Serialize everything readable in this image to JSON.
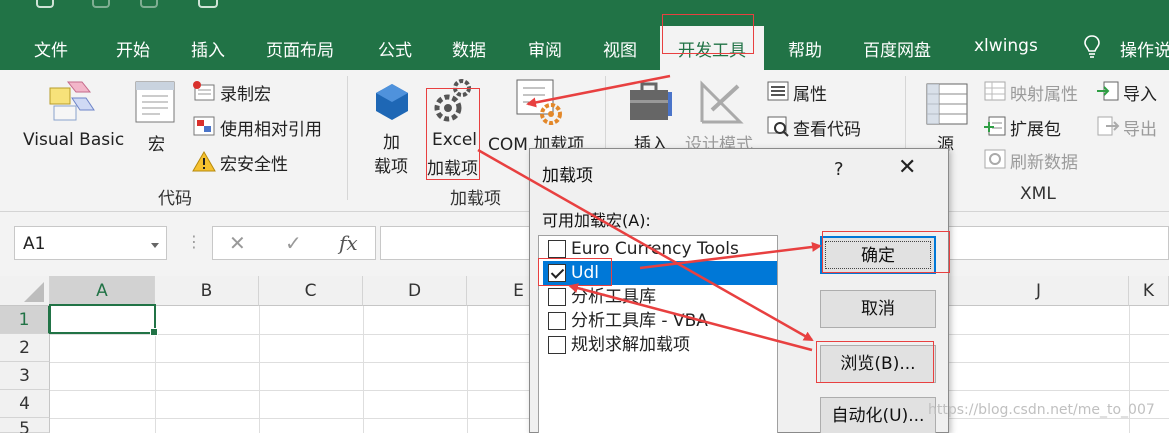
{
  "ribbon_tabs": [
    "文件",
    "开始",
    "插入",
    "页面布局",
    "公式",
    "数据",
    "审阅",
    "视图",
    "开发工具",
    "帮助",
    "百度网盘",
    "xlwings",
    "操作说"
  ],
  "active_tab": "开发工具",
  "code_group": {
    "visual_basic": "Visual Basic",
    "macros": "宏",
    "record_macro": "录制宏",
    "use_relative_refs": "使用相对引用",
    "macro_security": "宏安全性",
    "label": "代码"
  },
  "addins_group": {
    "addins_line1": "加",
    "addins_line2": "载项",
    "excel_addins_line1": "Excel",
    "excel_addins_line2": "加载项",
    "com_addins": "COM 加载项",
    "label": "加载项"
  },
  "controls_group": {
    "insert": "插入",
    "design_mode": "设计模式",
    "properties": "属性",
    "view_code": "查看代码"
  },
  "xml_group": {
    "source": "源",
    "map_properties": "映射属性",
    "expansion_packs": "扩展包",
    "refresh_data": "刷新数据",
    "import": "导入",
    "export": "导出",
    "label": "XML"
  },
  "formula_bar": {
    "name_box": "A1",
    "cancel": "✕",
    "enter": "✓",
    "fx": "fx"
  },
  "grid": {
    "columns": [
      "A",
      "B",
      "C",
      "D",
      "E",
      "J",
      "K"
    ],
    "rows": [
      "1",
      "2",
      "3",
      "4",
      "5"
    ]
  },
  "dialog": {
    "title": "加载项",
    "help": "?",
    "close": "✕",
    "list_label": "可用加载宏(A):",
    "items": [
      {
        "label": "Euro Currency Tools",
        "checked": false
      },
      {
        "label": "Udl",
        "checked": true
      },
      {
        "label": "分析工具库",
        "checked": false
      },
      {
        "label": "分析工具库 - VBA",
        "checked": false
      },
      {
        "label": "规划求解加载项",
        "checked": false
      }
    ],
    "ok": "确定",
    "cancel": "取消",
    "browse": "浏览(B)...",
    "automation": "自动化(U)..."
  },
  "watermark": "https://blog.csdn.net/me_to_007",
  "colors": {
    "accent": "#217346",
    "selection": "#0078d7",
    "annotation": "#e84040"
  }
}
